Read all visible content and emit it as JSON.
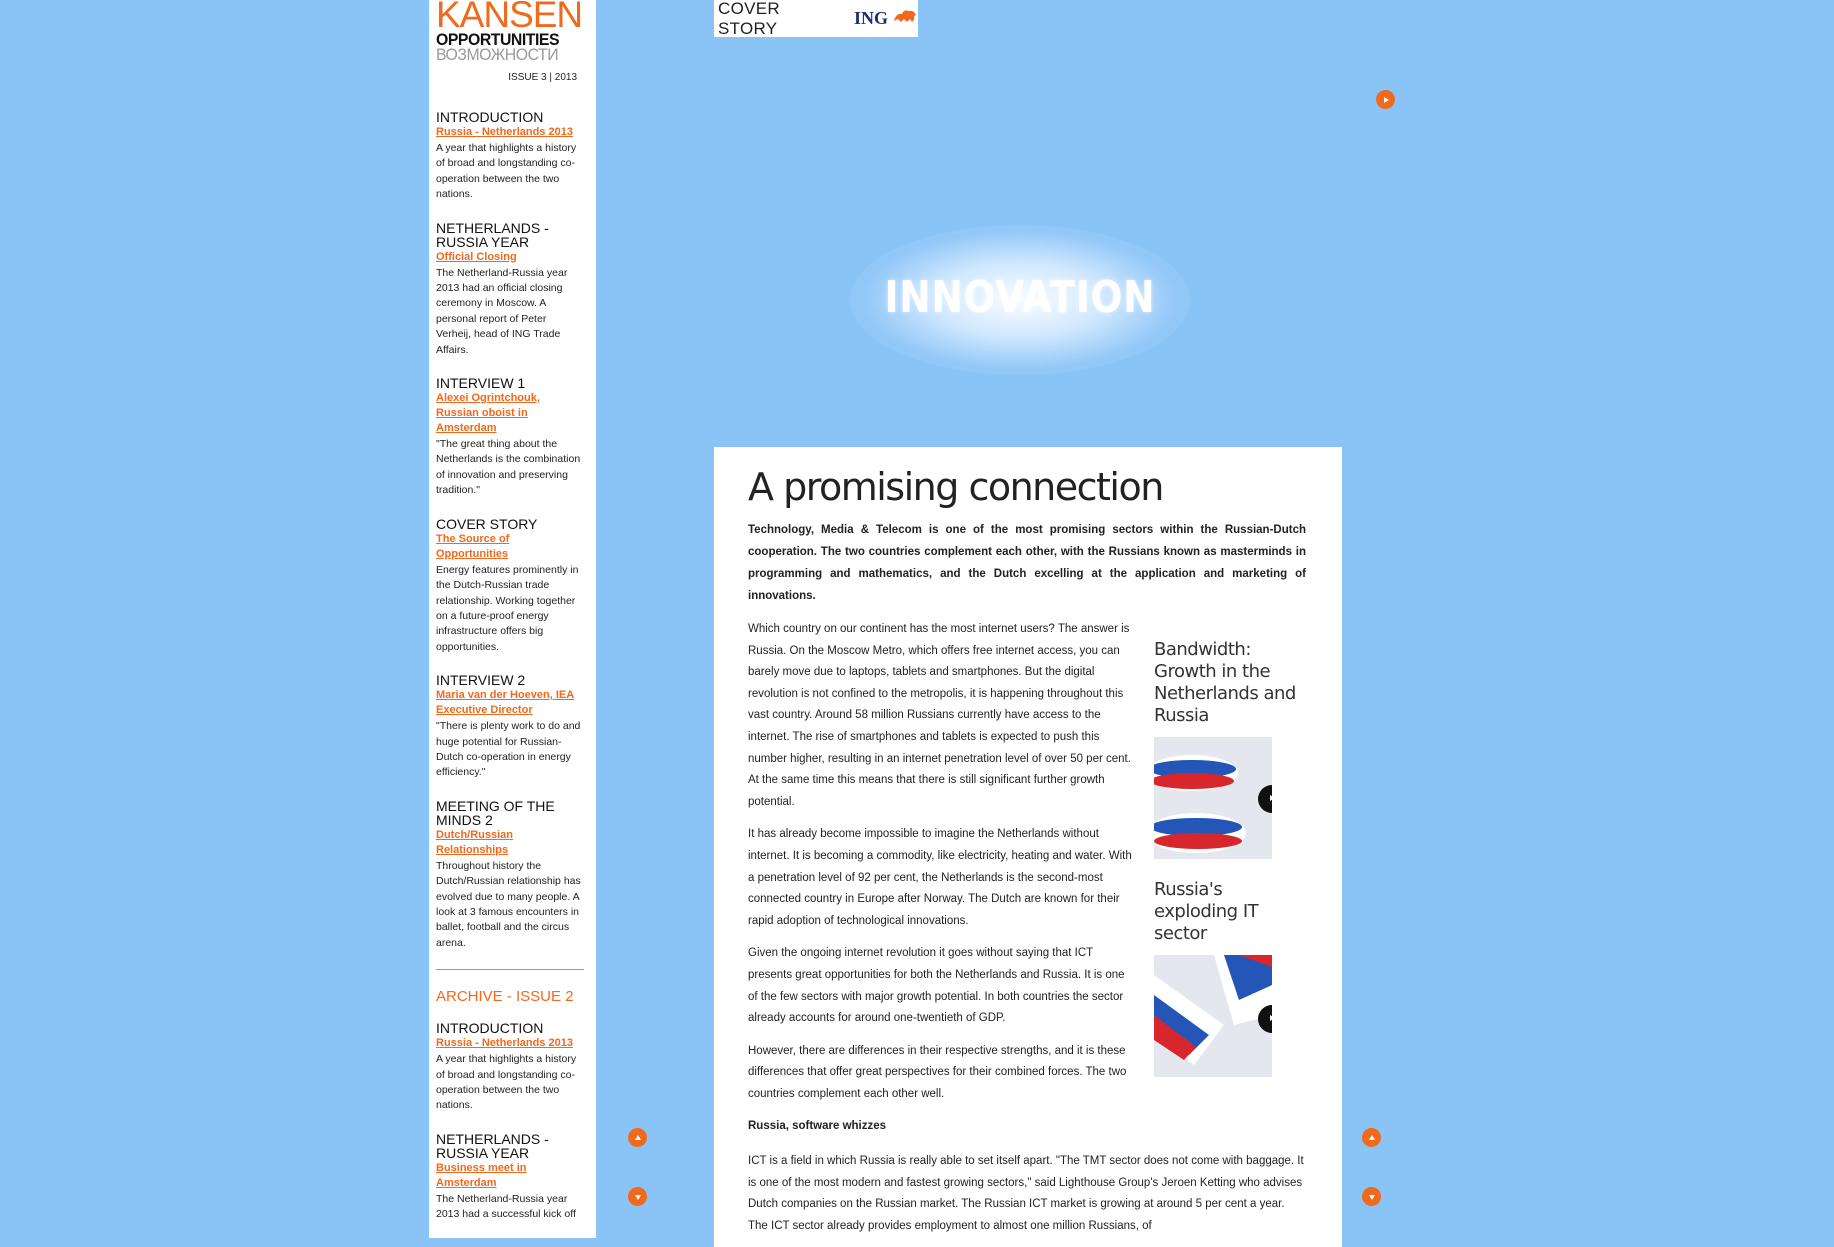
{
  "logo": {
    "main": "KANSEN",
    "en": "OPPORTUNITIES",
    "ru": "ВОЗМОЖНОСТИ"
  },
  "issue": "ISSUE 3 | 2013",
  "toc": [
    {
      "heading": "INTRODUCTION",
      "link": "Russia - Netherlands 2013",
      "desc": "A year that highlights a history of broad and longstanding co-operation between the two nations."
    },
    {
      "heading": "NETHERLANDS - RUSSIA YEAR",
      "link": "Official Closing",
      "desc": "The Netherland-Russia year 2013 had an official closing ceremony in Moscow. A personal report of Peter Verheij, head of ING Trade Affairs."
    },
    {
      "heading": "INTERVIEW 1",
      "link": "Alexei Ogrintchouk, Russian oboist in Amsterdam",
      "desc": "\"The great thing about the Netherlands is the combination of innovation and preserving tradition.\""
    },
    {
      "heading": "COVER STORY",
      "link": "The Source of Opportunities",
      "desc": "Energy features prominently in the Dutch-Russian trade relationship. Working together on a future-proof energy infrastructure offers big opportunities."
    },
    {
      "heading": "INTERVIEW 2",
      "link": "Maria van der Hoeven, IEA Executive Director",
      "desc": "\"There is plenty work to do and huge potential for Russian-Dutch co-operation in energy efficiency.\""
    },
    {
      "heading": "MEETING OF THE MINDS 2",
      "link": "Dutch/Russian Relationships",
      "desc": "Throughout history the Dutch/Russian relationship has evolved due to many people. A look at 3 famous encounters in ballet, football and the circus arena."
    }
  ],
  "archive": {
    "heading": "ARCHIVE - ISSUE 2",
    "items": [
      {
        "heading": "INTRODUCTION",
        "link": "Russia - Netherlands 2013",
        "desc": "A year that highlights a history of broad and longstanding co-operation between the two nations."
      },
      {
        "heading": "NETHERLANDS - RUSSIA YEAR",
        "link": "Business meet in Amsterdam",
        "desc": "The Netherland-Russia year 2013 had a successful kick off"
      }
    ]
  },
  "badge": {
    "label": "COVER STORY",
    "brand": "ING"
  },
  "hero": {
    "title": "INNOVATION"
  },
  "article": {
    "title": "A promising connection",
    "lead": "Technology, Media & Telecom is one of the most promising sectors within the Russian-Dutch cooperation. The two countries complement each other, with the Russians known as masterminds in programming and mathematics, and the Dutch excelling at the application and marketing of innovations.",
    "p1": "Which country on our continent has the most internet users? The answer is Russia. On the Moscow Metro, which offers free internet access, you can barely move due to laptops, tablets and smartphones. But the digital revolution is not confined to the metropolis, it is happening throughout this vast country. Around 58 million Russians currently have access to the internet. The rise of smartphones and tablets is expected to push this number higher, resulting in an internet penetration level of over 50 per cent. At the same time this means that there is still significant further growth potential.",
    "p2": "It has already become impossible to imagine the Netherlands without internet. It is becoming a commodity, like electricity, heating and water. With a penetration level of 92 per cent, the Netherlands is the second-most connected country in Europe after Norway. The Dutch are known for their rapid adoption of technological innovations.",
    "p3": "Given the ongoing internet revolution it goes without saying that ICT presents great opportunities for both the Netherlands and Russia. It is one of the few sectors with major growth potential. In both countries the sector already accounts for around one-twentieth of GDP.",
    "p4": "However, there are differences in their respective strengths, and it is these differences that offer great perspectives for their combined forces. The two countries complement each other well.",
    "subhead": "Russia, software whizzes",
    "p5": "ICT is a field in which Russia is really able to set itself apart. \"The TMT sector does not come with baggage. It is one of the most modern and fastest growing sectors,\" said Lighthouse Group's Jeroen Ketting who advises Dutch companies on the Russian market. The Russian ICT market is growing at around 5 per cent a year. The ICT sector already provides employment to almost one million Russians, of",
    "videos": [
      {
        "title": "Bandwidth: Growth in the Netherlands and Russia"
      },
      {
        "title": "Russia's exploding IT sector"
      }
    ]
  },
  "colors": {
    "background": "#8ac4f7",
    "accent": "#f0691c",
    "brand": "#1d2e73"
  }
}
